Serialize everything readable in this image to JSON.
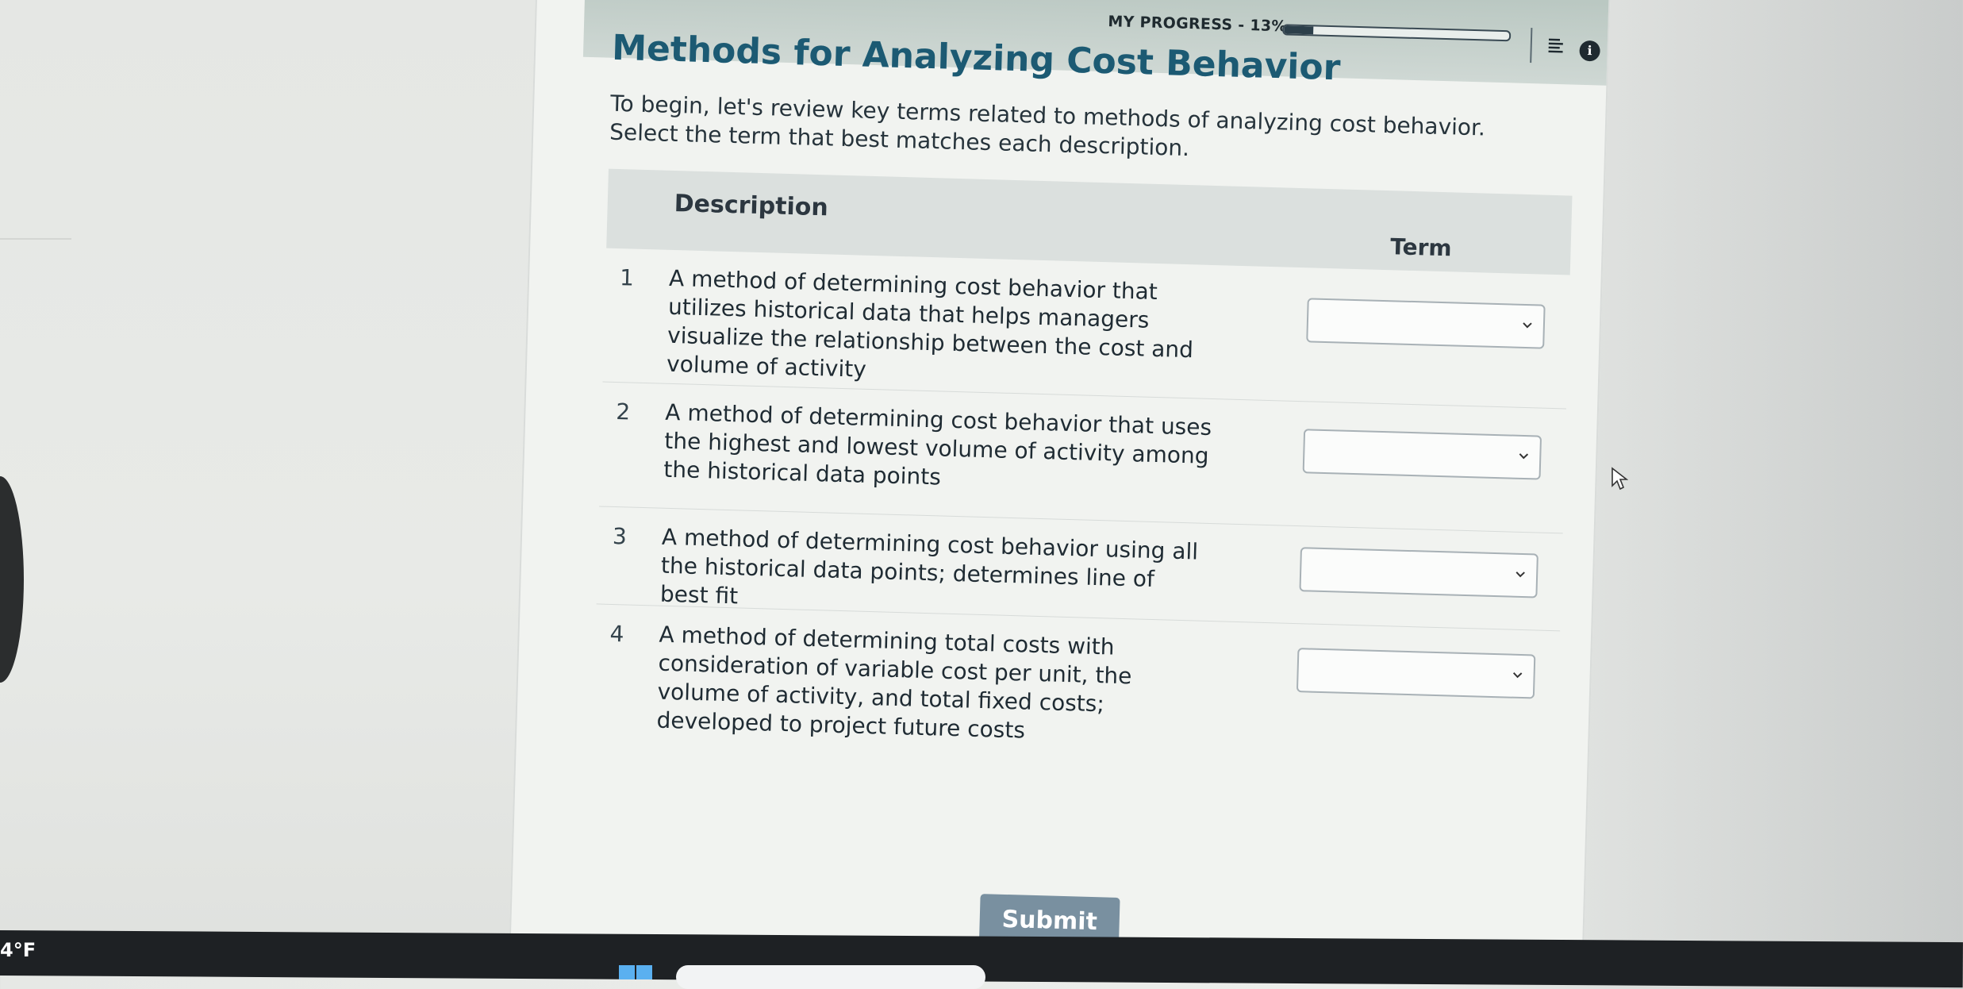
{
  "header": {
    "progress_label": "MY PROGRESS - 13%",
    "progress_value": 0.13
  },
  "page": {
    "title": "Methods for Analyzing Cost Behavior",
    "instructions": "To begin, let's review key terms related to methods of analyzing cost behavior. Select the term that best matches each description."
  },
  "table": {
    "headers": {
      "description": "Description",
      "term": "Term"
    },
    "rows": [
      {
        "number": "1",
        "description": "A method of determining cost behavior that utilizes historical data that helps managers visualize the relationship between the cost and volume of activity",
        "selected_term": ""
      },
      {
        "number": "2",
        "description": "A method of determining cost behavior that uses the highest and lowest volume of activity among the historical data points",
        "selected_term": ""
      },
      {
        "number": "3",
        "description": "A method of determining cost behavior using all the historical data points; determines line of best fit",
        "selected_term": ""
      },
      {
        "number": "4",
        "description": "A method of determining total costs with consideration of variable cost per unit, the volume of activity, and total fixed costs; developed to project future costs",
        "selected_term": ""
      }
    ]
  },
  "actions": {
    "submit_label": "Submit"
  },
  "taskbar": {
    "weather_temp": "4°F"
  },
  "icons": {
    "menu": "menu-lines-icon",
    "info": "info-icon",
    "dropdown": "chevron-down-icon",
    "cursor": "mouse-pointer-icon",
    "start": "windows-icon"
  }
}
